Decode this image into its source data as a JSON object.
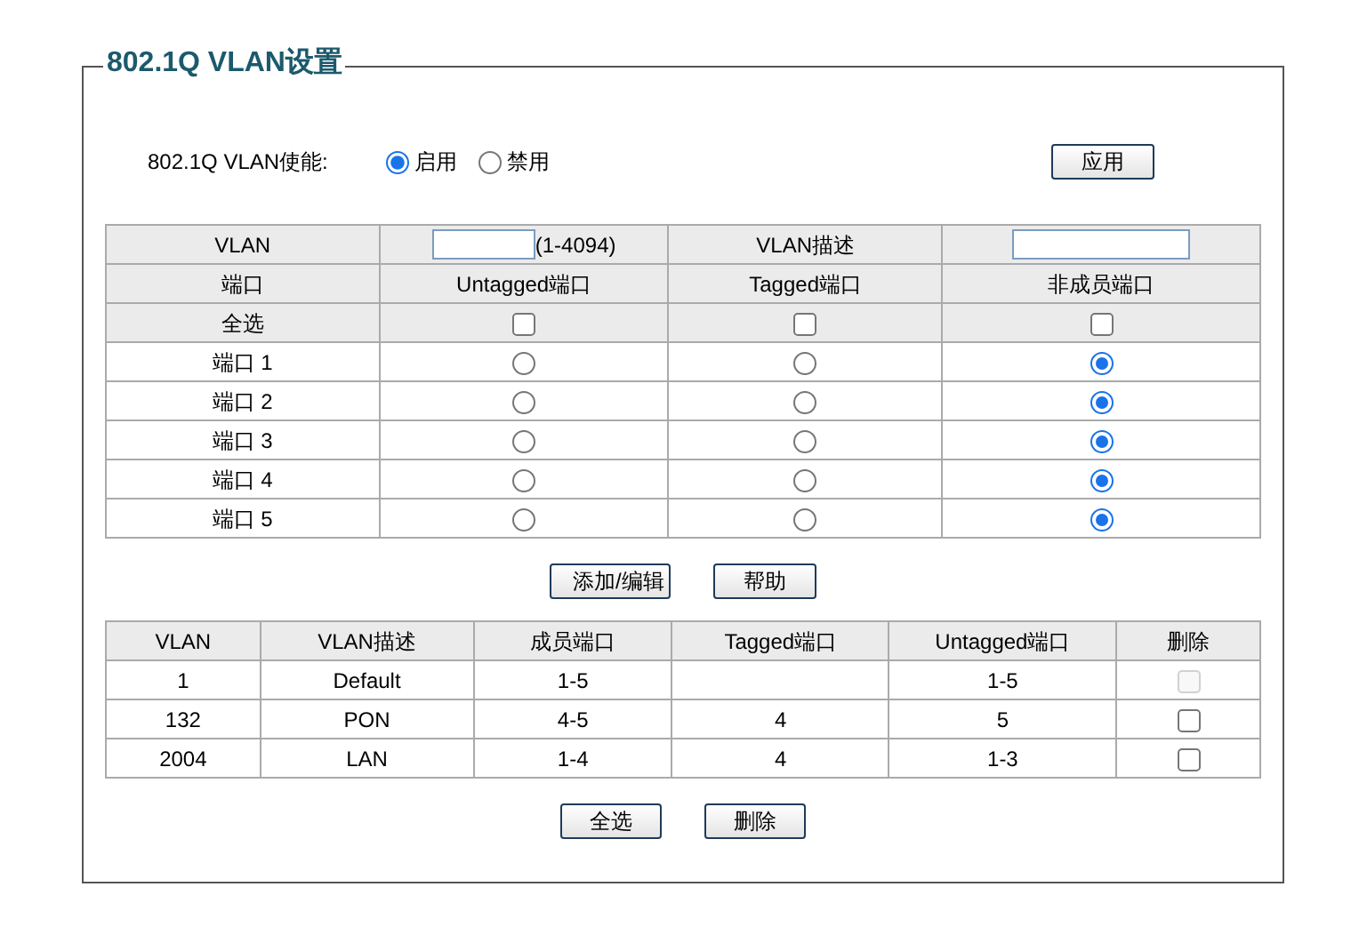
{
  "section": {
    "title": "802.1Q VLAN设置"
  },
  "enable": {
    "label": "802.1Q VLAN使能:",
    "options": [
      {
        "label": "启用",
        "selected": true
      },
      {
        "label": "禁用",
        "selected": false
      }
    ],
    "apply_button": "应用"
  },
  "edit_table": {
    "vlan_label": "VLAN",
    "vlan_range": "(1-4094)",
    "desc_label": "VLAN描述",
    "columns": [
      "端口",
      "Untagged端口",
      "Tagged端口",
      "非成员端口"
    ],
    "select_all": {
      "label": "全选",
      "checks": [
        {
          "checked": false
        },
        {
          "checked": false
        },
        {
          "checked": false
        }
      ]
    },
    "ports": [
      {
        "label": "端口 1",
        "options": [
          {
            "selected": false
          },
          {
            "selected": false
          },
          {
            "selected": true
          }
        ]
      },
      {
        "label": "端口 2",
        "options": [
          {
            "selected": false
          },
          {
            "selected": false
          },
          {
            "selected": true
          }
        ]
      },
      {
        "label": "端口 3",
        "options": [
          {
            "selected": false
          },
          {
            "selected": false
          },
          {
            "selected": true
          }
        ]
      },
      {
        "label": "端口 4",
        "options": [
          {
            "selected": false
          },
          {
            "selected": false
          },
          {
            "selected": true
          }
        ]
      },
      {
        "label": "端口 5",
        "options": [
          {
            "selected": false
          },
          {
            "selected": false
          },
          {
            "selected": true
          }
        ]
      }
    ]
  },
  "edit_buttons": [
    "添加/编辑",
    "帮助"
  ],
  "vlan_table": {
    "columns": [
      "VLAN",
      "VLAN描述",
      "成员端口",
      "Tagged端口",
      "Untagged端口",
      "删除"
    ],
    "rows": [
      {
        "cells": [
          "1",
          "Default",
          "1-5",
          "",
          "1-5"
        ],
        "checked": false,
        "disabled": true
      },
      {
        "cells": [
          "132",
          "PON",
          "4-5",
          "4",
          "5"
        ],
        "checked": false,
        "disabled": false
      },
      {
        "cells": [
          "2004",
          "LAN",
          "1-4",
          "4",
          "1-3"
        ],
        "checked": false,
        "disabled": false
      }
    ]
  },
  "bottom_buttons": [
    "全选",
    "删除"
  ]
}
